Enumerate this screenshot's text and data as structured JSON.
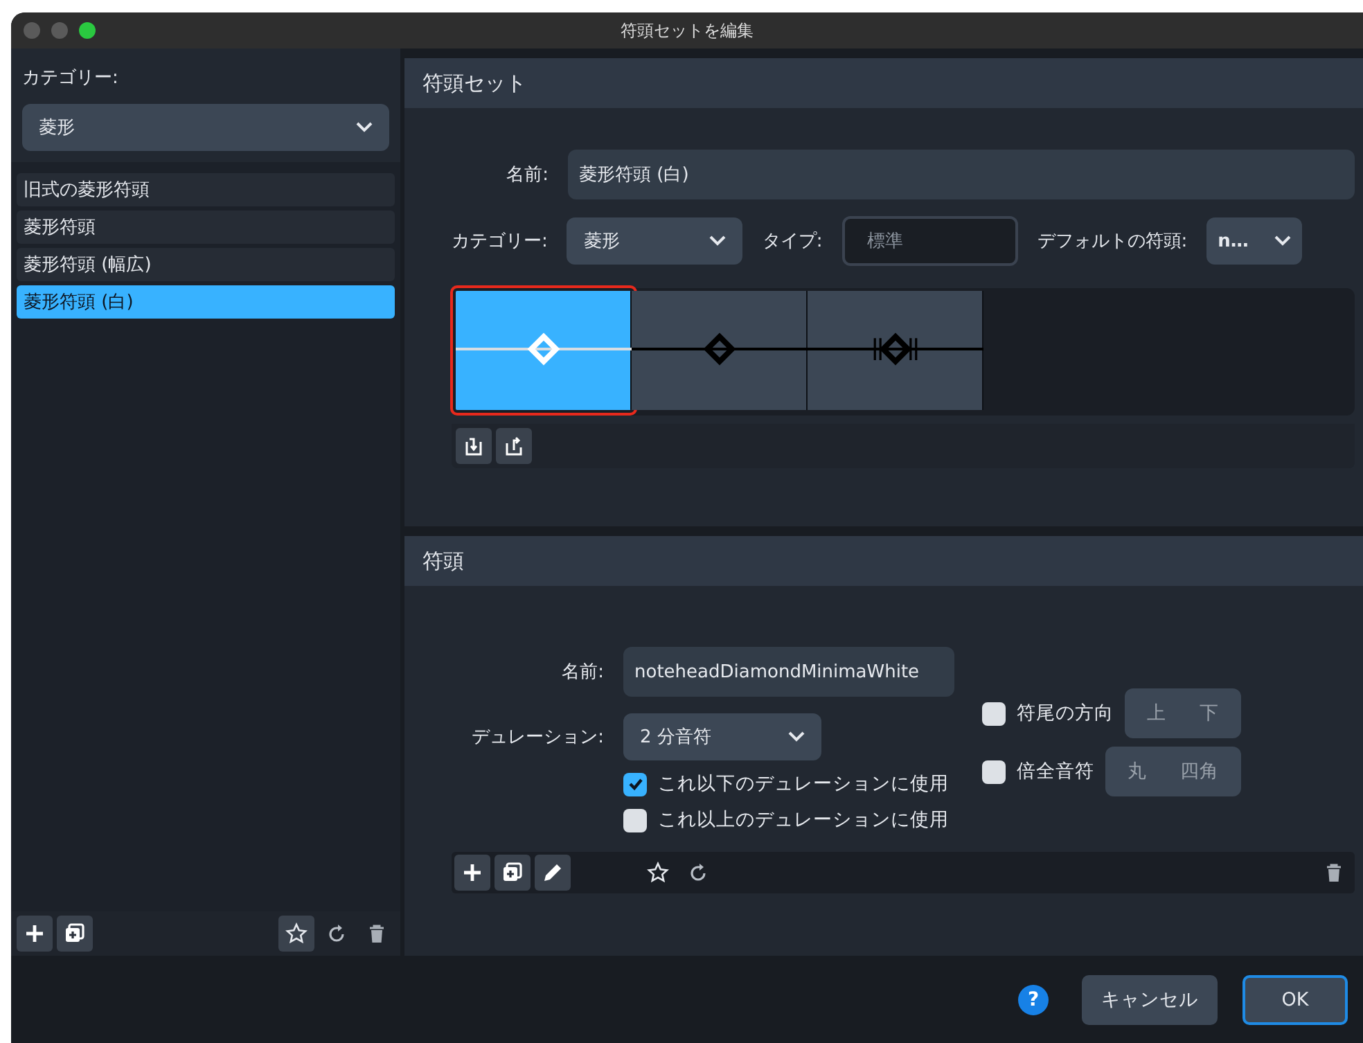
{
  "window": {
    "title": "符頭セットを編集"
  },
  "sidebar": {
    "category_label": "カテゴリー:",
    "category_value": "菱形",
    "items": [
      {
        "label": "旧式の菱形符頭",
        "selected": false
      },
      {
        "label": "菱形符頭",
        "selected": false
      },
      {
        "label": "菱形符頭 (幅広)",
        "selected": false
      },
      {
        "label": "菱形符頭 (白)",
        "selected": true
      }
    ]
  },
  "notehead_set": {
    "title": "符頭セット",
    "name_label": "名前:",
    "name_value": "菱形符頭 (白)",
    "category_label": "カテゴリー:",
    "category_value": "菱形",
    "type_label": "タイプ:",
    "type_placeholder": "標準",
    "default_label": "デフォルトの符頭:",
    "default_value": "n…",
    "noteheads": [
      {
        "kind": "diamond",
        "selected": true
      },
      {
        "kind": "diamond",
        "selected": false
      },
      {
        "kind": "diamond_breve",
        "selected": false
      }
    ]
  },
  "notehead": {
    "title": "符頭",
    "name_label": "名前:",
    "name_value": "noteheadDiamondMinimaWhite",
    "duration_label": "デュレーション:",
    "duration_value": "2 分音符",
    "use_below": {
      "label": "これ以下のデュレーションに使用",
      "checked": true
    },
    "use_above": {
      "label": "これ以上のデュレーションに使用",
      "checked": false
    },
    "stem_direction": {
      "label": "符尾の方向",
      "checked": false,
      "options": [
        "上",
        "下"
      ]
    },
    "double_whole": {
      "label": "倍全音符",
      "checked": false,
      "options": [
        "丸",
        "四角"
      ]
    }
  },
  "footer": {
    "help": "?",
    "cancel": "キャンセル",
    "ok": "OK"
  }
}
